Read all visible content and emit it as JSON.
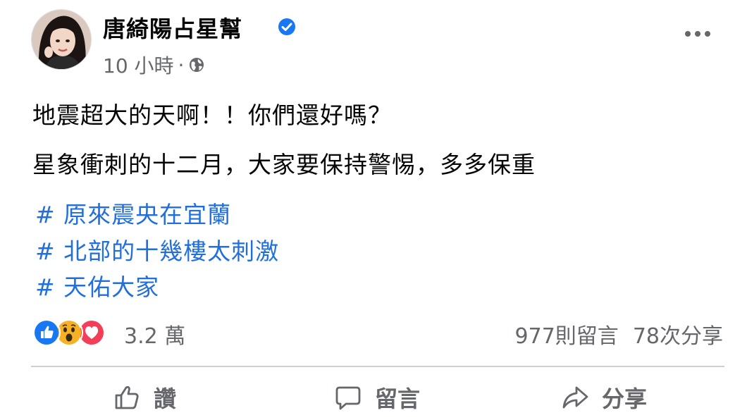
{
  "post": {
    "author": "唐綺陽占星幫",
    "timestamp": "10 小時",
    "separator": "·",
    "lines": [
      "地震超大的天啊！！你們還好嗎？",
      "星象衝刺的十二月，大家要保持警惕，多多保重"
    ],
    "hashtags": [
      "# 原來震央在宜蘭",
      "# 北部的十幾樓太刺激",
      "# 天佑大家"
    ],
    "reaction_count": "3.2 萬",
    "comments": "977則留言",
    "shares": "78次分享",
    "actions": {
      "like": "讚",
      "comment": "留言",
      "share": "分享"
    }
  },
  "colors": {
    "accent": "#1877f2",
    "hashtag": "#216fdb",
    "secondary_text": "#65676b",
    "divider": "#ced0d4"
  },
  "icons": [
    "verified-badge-icon",
    "globe-icon",
    "more-options-icon",
    "like-reaction-icon",
    "wow-reaction-icon",
    "love-reaction-icon",
    "thumbs-up-icon",
    "comment-bubble-icon",
    "share-arrow-icon"
  ]
}
